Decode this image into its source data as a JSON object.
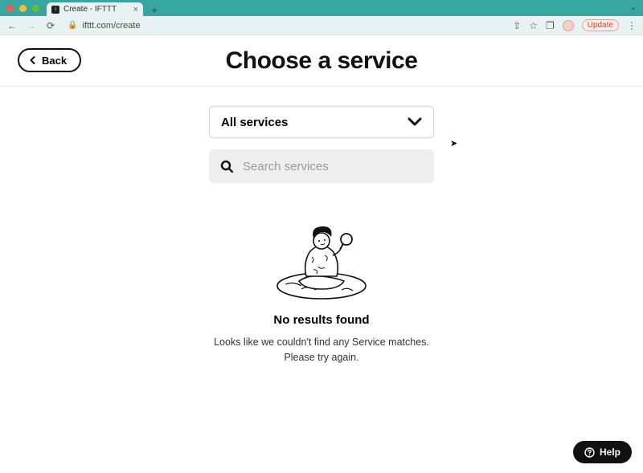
{
  "os": {
    "traffic": [
      "close",
      "minimize",
      "zoom"
    ]
  },
  "browser": {
    "tab_title": "Create - IFTTT",
    "url": "ifttt.com/create",
    "update_label": "Update"
  },
  "header": {
    "back_label": "Back",
    "title": "Choose a service"
  },
  "filter": {
    "selected": "All services"
  },
  "search": {
    "placeholder": "Search services",
    "value": ""
  },
  "empty_state": {
    "title": "No results found",
    "line1": "Looks like we couldn't find any Service matches.",
    "line2": "Please try again."
  },
  "help": {
    "label": "Help"
  }
}
